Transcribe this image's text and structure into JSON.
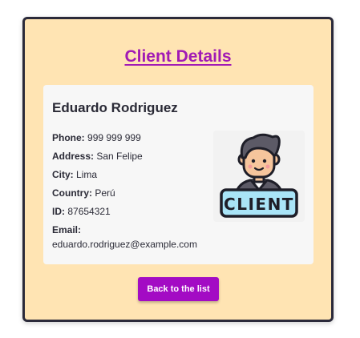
{
  "header": {
    "title": "Client Details"
  },
  "client": {
    "name": "Eduardo Rodriguez",
    "fields": {
      "phone": {
        "label": "Phone:",
        "value": "999 999 999"
      },
      "address": {
        "label": "Address:",
        "value": "San Felipe"
      },
      "city": {
        "label": "City:",
        "value": "Lima"
      },
      "country": {
        "label": "Country:",
        "value": "Perú"
      },
      "id": {
        "label": "ID:",
        "value": "87654321"
      },
      "email": {
        "label": "Email:",
        "value": "eduardo.rodriguez@example.com"
      }
    },
    "avatar_icon": "client-avatar-icon",
    "avatar_badge_text": "CLIENT"
  },
  "actions": {
    "back_label": "Back to the list"
  },
  "colors": {
    "card_background": "#ffe4b3",
    "card_border": "#2b2a3a",
    "accent": "#a11ab5",
    "button": "#a30bc4"
  }
}
